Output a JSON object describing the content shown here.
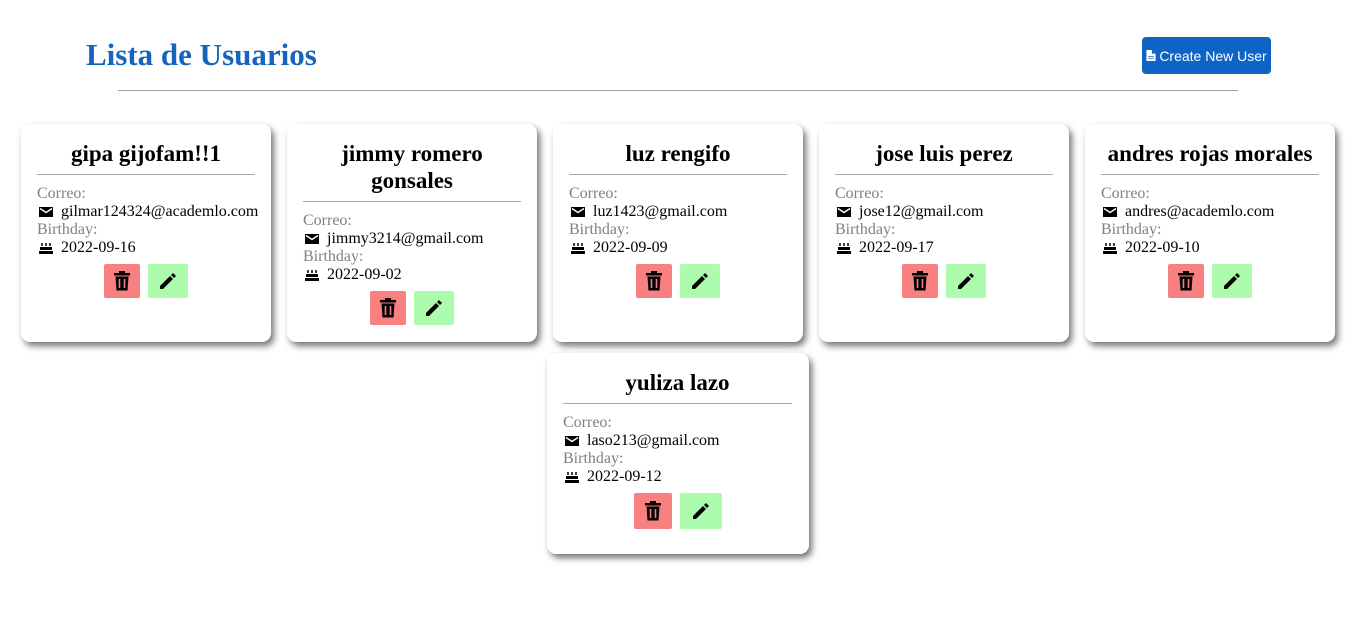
{
  "header": {
    "title": "Lista de Usuarios",
    "create_label": "Create New User"
  },
  "labels": {
    "email": "Correo:",
    "birthday": "Birthday:"
  },
  "users": [
    {
      "name": "gipa gijofam!!1",
      "email": "gilmar124324@academlo.com",
      "birthday": "2022-09-16"
    },
    {
      "name": "jimmy romero gonsales",
      "email": "jimmy3214@gmail.com",
      "birthday": "2022-09-02"
    },
    {
      "name": "luz rengifo",
      "email": "luz1423@gmail.com",
      "birthday": "2022-09-09"
    },
    {
      "name": "jose luis perez",
      "email": "jose12@gmail.com",
      "birthday": "2022-09-17"
    },
    {
      "name": "andres rojas morales",
      "email": "andres@academlo.com",
      "birthday": "2022-09-10"
    },
    {
      "name": "yuliza lazo",
      "email": "laso213@gmail.com",
      "birthday": "2022-09-12"
    }
  ],
  "icons": {
    "create": "file-icon",
    "email": "envelope-icon",
    "birthday": "cake-icon",
    "delete": "trash-icon",
    "edit": "pencil-icon"
  },
  "colors": {
    "title": "#1565c0",
    "primary_button": "#0d64c6",
    "delete_button": "#f88080",
    "edit_button": "#adfcad",
    "label": "#808080"
  }
}
